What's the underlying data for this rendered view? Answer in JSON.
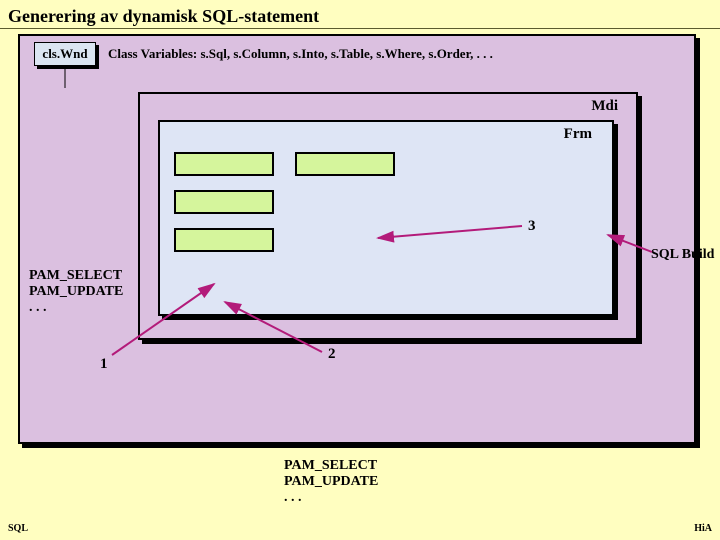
{
  "title": "Generering av dynamisk SQL-statement",
  "clsBox": "cls.Wnd",
  "classVars": "Class Variables:   s.Sql, s.Column, s.Into, s.Table, s.Where, s.Order, . . .",
  "mdi": "Mdi",
  "frm": "Frm",
  "step1": "1",
  "step2": "2",
  "step3": "3",
  "sqlBuild": "SQL Build",
  "pamUpper": {
    "l1": "PAM_SELECT",
    "l2": "PAM_UPDATE",
    "l3": ". . ."
  },
  "pamLower": {
    "l1": "PAM_SELECT",
    "l2": "PAM_UPDATE",
    "l3": ". . ."
  },
  "footerLeft": "SQL",
  "footerRight": "HiA"
}
